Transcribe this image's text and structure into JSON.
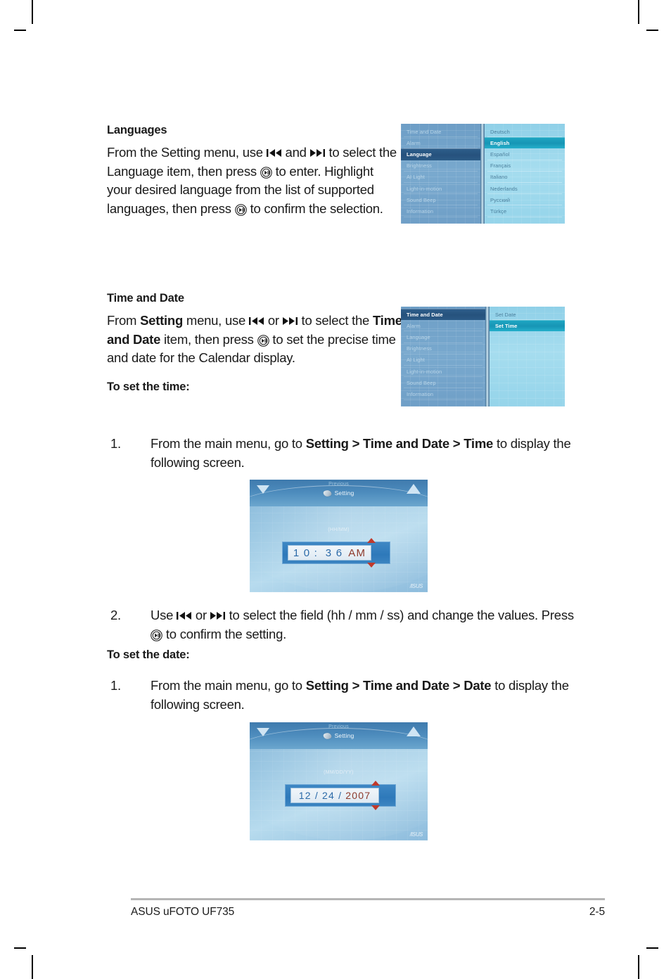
{
  "page": {
    "footer_left": "ASUS uFOTO UF735",
    "footer_right": "2-5"
  },
  "languages_section": {
    "heading": "Languages",
    "para_1": "From the Setting menu, use ",
    "para_2": " and ",
    "para_3": " to select the Language item, then press ",
    "para_4": " to enter. Highlight your desired language from the list of supported languages, then press ",
    "para_5": " to confirm the selection."
  },
  "time_date_section": {
    "heading": "Time and Date",
    "para_1": "From ",
    "para_1_b": "Setting",
    "para_2": " menu, use ",
    "para_3": " or ",
    "para_4": " to select the ",
    "para_4_b": "Time and Date",
    "para_5": " item, then press ",
    "para_6": " to set the precise time and date for the Calendar display.",
    "to_set_time": "To set the time:",
    "to_set_date": "To set the date:"
  },
  "steps": {
    "time_step_1_num": "1.",
    "time_step_1_a": "From the main menu, go to ",
    "time_step_1_b": "Setting > Time and Date > Time",
    "time_step_1_c": " to display the following screen.",
    "time_step_2_num": "2.",
    "time_step_2_a": "Use ",
    "time_step_2_b": " or ",
    "time_step_2_c": " to select the field (hh / mm / ss) and change the values. Press ",
    "time_step_2_d": " to confirm the setting.",
    "date_step_1_num": "1.",
    "date_step_1_a": "From the main menu, go to ",
    "date_step_1_b": "Setting > Time and Date > Date",
    "date_step_1_c": " to display the following screen."
  },
  "figure_language_menu": {
    "left_items": [
      {
        "label": "Time and Date",
        "selected": false
      },
      {
        "label": "Alarm",
        "selected": false
      },
      {
        "label": "Language",
        "selected": true
      },
      {
        "label": "Brightness",
        "selected": false
      },
      {
        "label": "AI Light",
        "selected": false
      },
      {
        "label": "Light-in-motion",
        "selected": false
      },
      {
        "label": "Sound Beep",
        "selected": false
      },
      {
        "label": "Information",
        "selected": false
      }
    ],
    "right_items": [
      {
        "label": "Deutsch",
        "selected": false
      },
      {
        "label": "English",
        "selected": true
      },
      {
        "label": "Español",
        "selected": false
      },
      {
        "label": "Français",
        "selected": false
      },
      {
        "label": "Italiano",
        "selected": false
      },
      {
        "label": "Nederlands",
        "selected": false
      },
      {
        "label": "Русский",
        "selected": false
      },
      {
        "label": "Türkçe",
        "selected": false
      }
    ]
  },
  "figure_timedate_menu": {
    "left_items": [
      {
        "label": "Time and Date",
        "selected": true
      },
      {
        "label": "Alarm",
        "selected": false
      },
      {
        "label": "Language",
        "selected": false
      },
      {
        "label": "Brightness",
        "selected": false
      },
      {
        "label": "AI Light",
        "selected": false
      },
      {
        "label": "Light-in-motion",
        "selected": false
      },
      {
        "label": "Sound Beep",
        "selected": false
      },
      {
        "label": "Information",
        "selected": false
      }
    ],
    "right_items": [
      {
        "label": "Set Date",
        "selected": false
      },
      {
        "label": "Set Time",
        "selected": true
      }
    ]
  },
  "figure_time_screen": {
    "previous_label": "Previous",
    "title": "Setting",
    "format_label": "(HH/MM)",
    "value_hour": "1 0",
    "value_sep": " :  ",
    "value_minute": "3 6",
    "value_ampm": "AM",
    "logo": "/ISUS"
  },
  "figure_date_screen": {
    "previous_label": "Previous",
    "title": "Setting",
    "format_label": "(MM/DD/YY)",
    "value_month": "12 /",
    "value_day": " 24 ",
    "value_sep": "/ ",
    "value_year": "2007",
    "logo": "/ISUS"
  },
  "colors": {
    "selected_left": "#2a5880",
    "selected_right": "#1ba5c2",
    "panel_left": "#749fc6",
    "panel_right": "#9dd8ec",
    "value_number": "#2b6aa8",
    "value_alt": "#8d3a2c",
    "spinner": "#c0392b"
  }
}
